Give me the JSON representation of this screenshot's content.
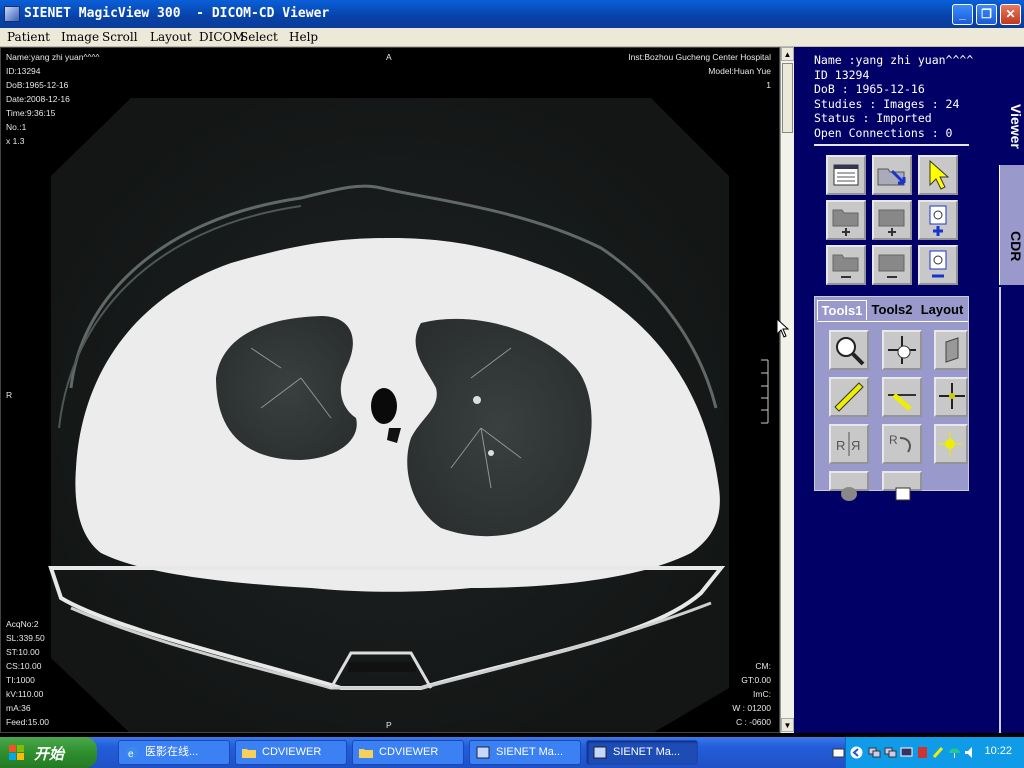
{
  "window": {
    "title": "SIENET MagicView 300  - DICOM-CD Viewer",
    "minimize": "_",
    "restore": "❐",
    "close": "✕"
  },
  "menu": [
    "Patient",
    "Image",
    "Scroll",
    "Layout",
    "DICOM",
    "Select",
    "Help"
  ],
  "overlay": {
    "top_left": [
      "Name:yang zhi yuan^^^^",
      "ID:13294",
      "DoB:1965-12-16",
      "Date:2008-12-16",
      "Time:9:36:15",
      "No.:1",
      "x 1.3"
    ],
    "top_center": "A",
    "top_right": [
      "Inst:Bozhou Gucheng Center Hospital",
      "Model:Huan Yue",
      "1"
    ],
    "left_center": "R",
    "bottom_center": "P",
    "bottom_left": [
      "AcqNo:2",
      "SL:339.50",
      "ST:10.00",
      "CS:10.00",
      "TI:1000",
      "kV:110.00",
      "mA:36",
      "Feed:15.00"
    ],
    "bottom_right": [
      "CM:",
      "GT:0.00",
      "ImC:",
      "W : 01200",
      "C : -0600"
    ]
  },
  "scrollbar": {
    "up": "▲",
    "down": "▼"
  },
  "panel": {
    "info": [
      "Name :yang zhi yuan^^^^",
      "ID 13294",
      "DoB : 1965-12-16",
      "Studies : Images : 24",
      "Status : Imported",
      "Open Connections : 0"
    ],
    "vtabs": {
      "viewer": "Viewer",
      "cdr": "CDR"
    },
    "top_buttons": [
      "list-icon",
      "open-folder-arrow-icon",
      "pointer-icon",
      "add-folder-icon",
      "add-folder-gray-icon",
      "add-image-icon",
      "remove-folder-icon",
      "remove-folder-gray-icon",
      "remove-image-icon"
    ],
    "tools_tabs": [
      "Tools1",
      "Tools2",
      "Layout"
    ],
    "tools": [
      "magnifier-icon",
      "pan-move-icon",
      "cube-icon",
      "ruler-icon",
      "angle-icon",
      "crosshair-icon",
      "flip-horizontal-icon",
      "rotate-icon",
      "brightness-icon",
      "blob-icon",
      "document-icon"
    ]
  },
  "taskbar": {
    "start": "开始",
    "tasks": [
      "医影在线...",
      "CDVIEWER",
      "CDVIEWER",
      "SIENET Ma...",
      "SIENET Ma..."
    ],
    "clock": "10:22"
  },
  "colors": {
    "panel_bg": "#000066",
    "tab_bg": "#9999cc",
    "title_blue": "#0842a8"
  }
}
